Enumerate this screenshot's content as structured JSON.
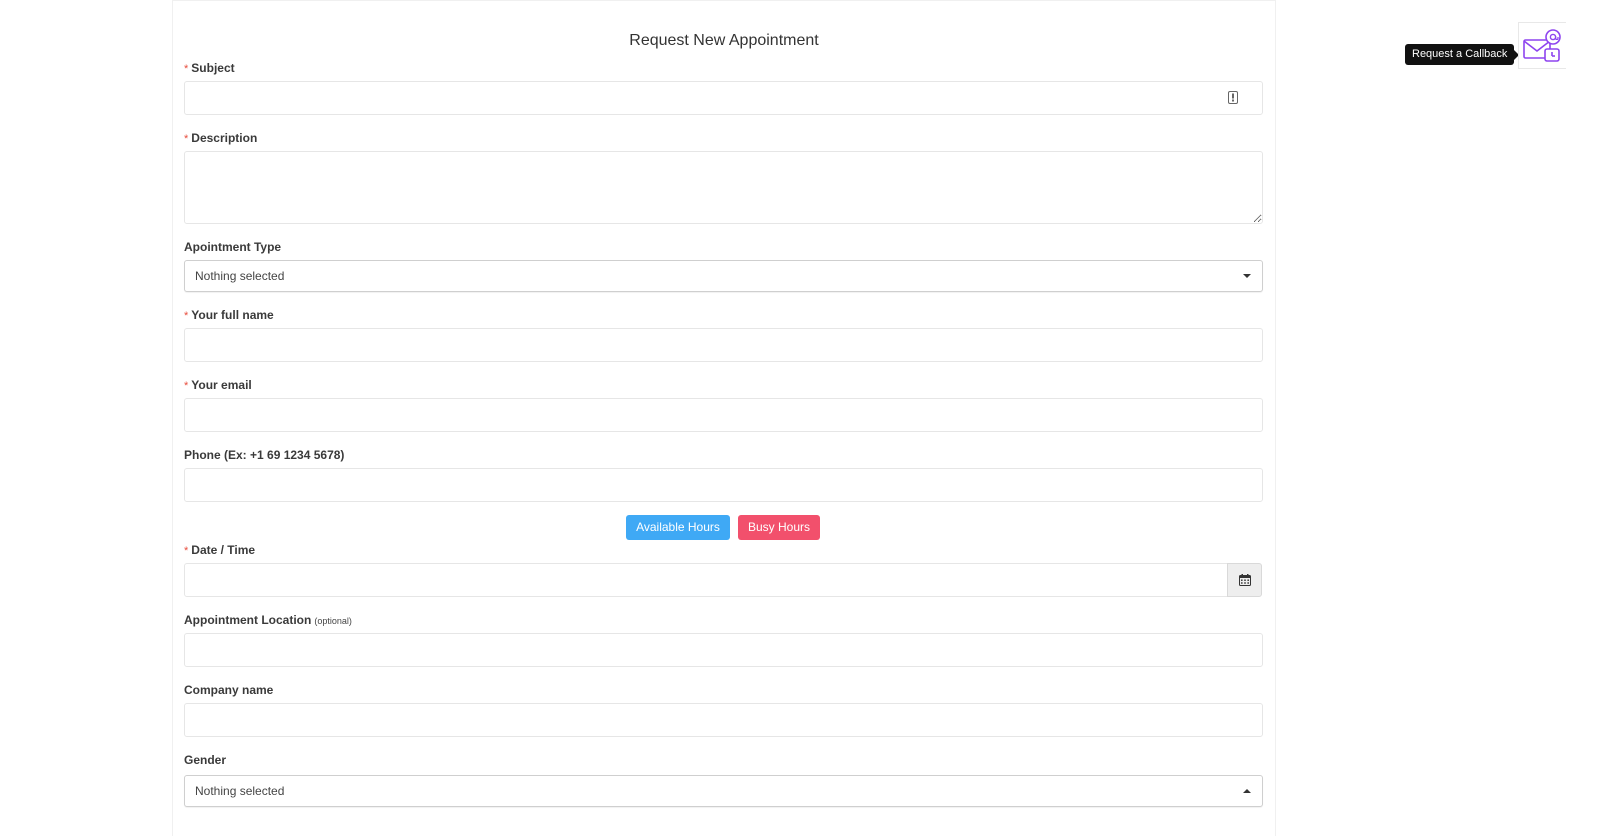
{
  "form": {
    "title": "Request New Appointment",
    "required_marker": "*",
    "subject": {
      "label": "Subject",
      "value": ""
    },
    "description": {
      "label": "Description",
      "value": ""
    },
    "appointment_type": {
      "label": "Apointment Type",
      "selected": "Nothing selected"
    },
    "full_name": {
      "label": "Your full name",
      "value": ""
    },
    "email": {
      "label": "Your email",
      "value": ""
    },
    "phone": {
      "label": "Phone (Ex: +1 69 1234 5678)",
      "value": ""
    },
    "hours_buttons": {
      "available": "Available Hours",
      "busy": "Busy Hours",
      "available_color": "#3fa9f5",
      "busy_color": "#f2506c"
    },
    "date_time": {
      "label": "Date / Time",
      "value": "",
      "addon_icon": "calendar-icon"
    },
    "location": {
      "label": "Appointment Location",
      "optional": "(optional)",
      "value": ""
    },
    "company": {
      "label": "Company name",
      "value": ""
    },
    "gender": {
      "label": "Gender",
      "selected": "Nothing selected"
    }
  },
  "callback": {
    "tooltip": "Request a Callback",
    "icon": "mail-callback-icon",
    "accent_color": "#8e44ef"
  }
}
